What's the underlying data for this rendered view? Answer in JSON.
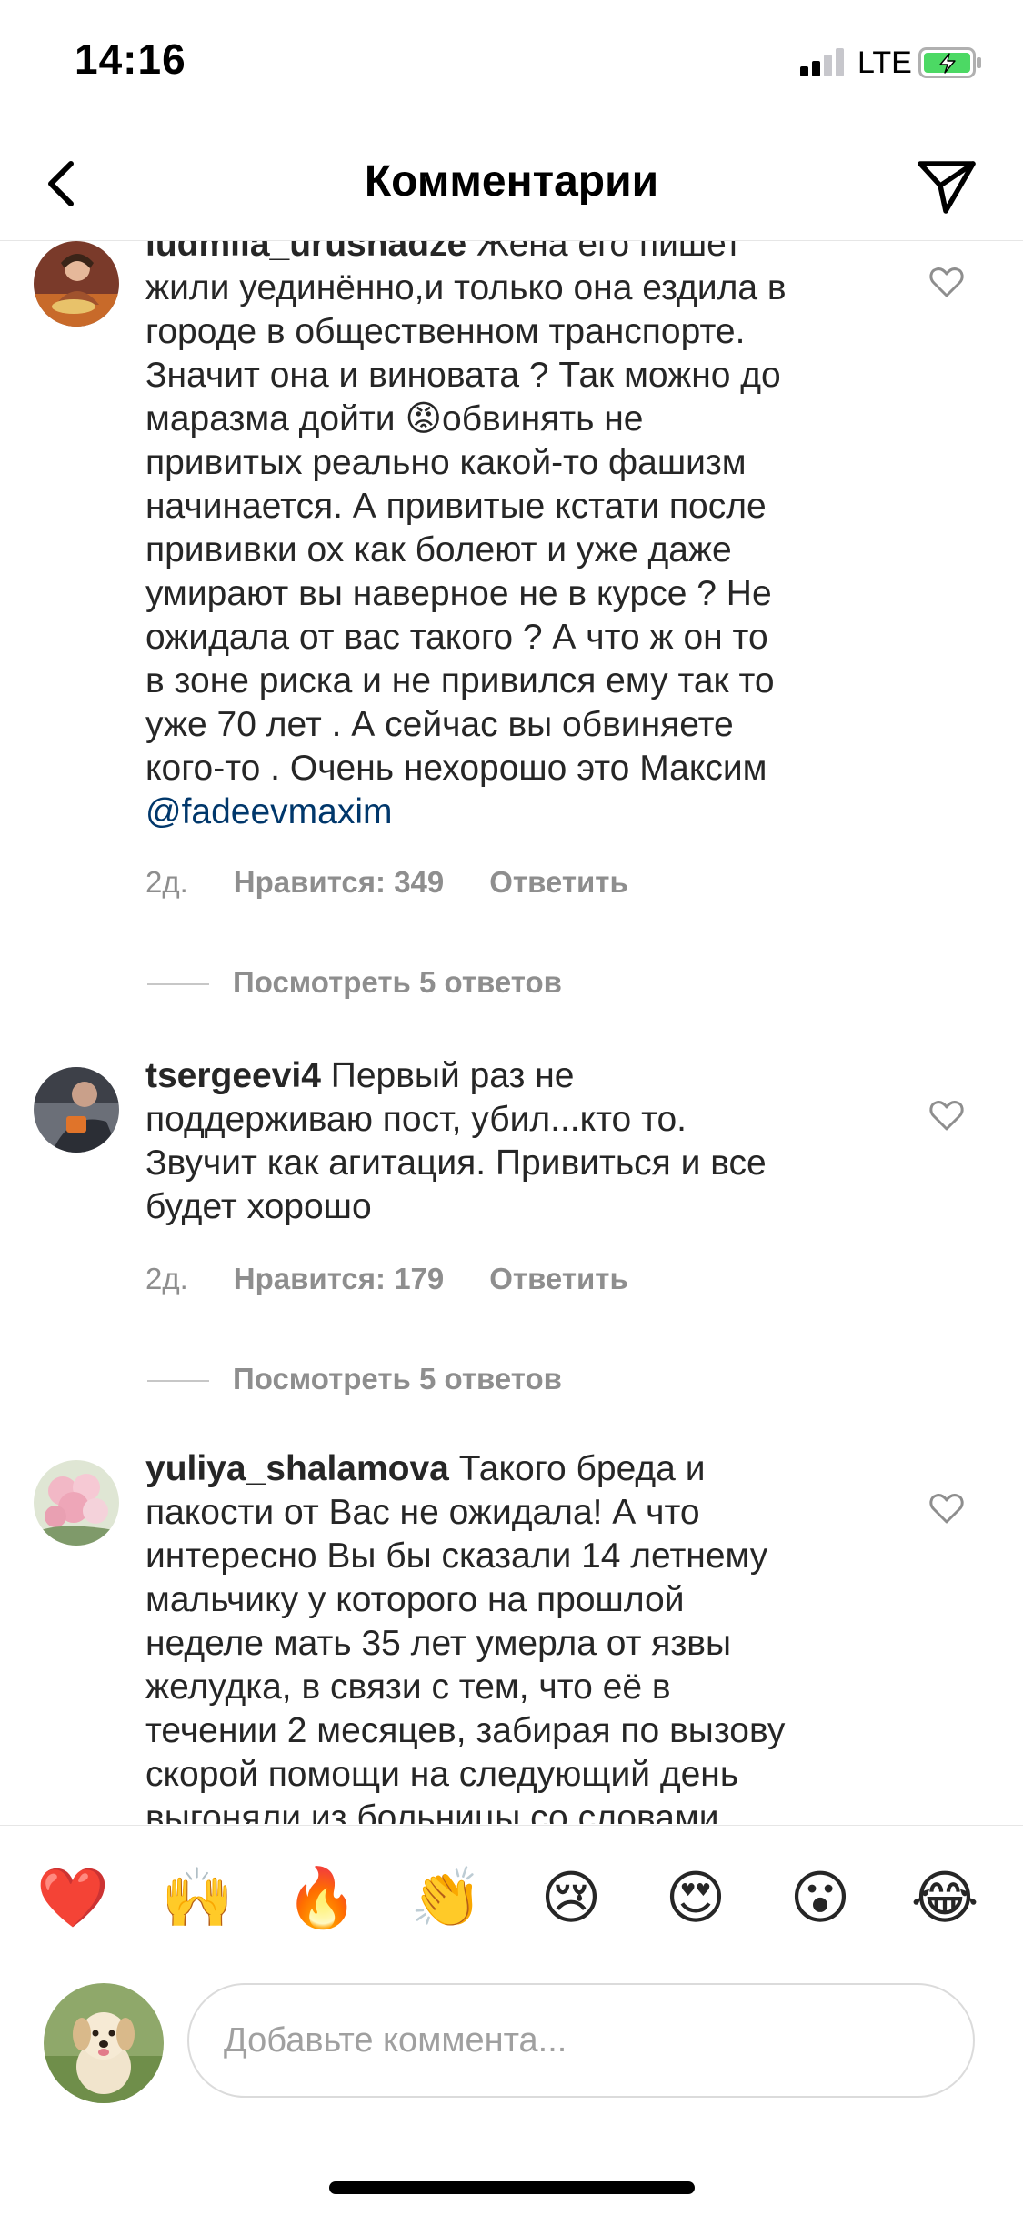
{
  "status_bar": {
    "time": "14:16",
    "network": "LTE",
    "battery_color": "#4cd964"
  },
  "header": {
    "title": "Комментарии",
    "back_icon": "chevron-left-icon",
    "send_icon": "paper-plane-icon"
  },
  "comments": [
    {
      "username": "ludmila_urushadze",
      "text_lines": [
        " Жена его пишет",
        "жили уединённо,и только она ездила в",
        "городе в общественном транспорте.",
        "Значит она и виновата ? Так можно до",
        "маразма дойти 😡обвинять не",
        "привитых реально какой-то фашизм",
        "начинается. А привитые кстати после",
        "прививки ох как болеют и уже даже",
        "умирают вы наверное не в курсе ? Не",
        "ожидала от вас такого ? А что ж он то",
        "в зоне риска и не привился ему так то",
        "уже 70 лет . А сейчас вы обвиняете",
        "кого-то . Очень нехорошо это Максим"
      ],
      "mention": "@fadeevmaxim",
      "time": "2д.",
      "likes": "Нравится: 349",
      "reply": "Ответить",
      "view_replies": "Посмотреть 5 ответов"
    },
    {
      "username": "tsergeevi4",
      "text_lines": [
        " Первый раз не",
        "поддерживаю пост, убил...кто то.",
        "Звучит как агитация. Привиться и все",
        "будет хорошо"
      ],
      "time": "2д.",
      "likes": "Нравится: 179",
      "reply": "Ответить",
      "view_replies": "Посмотреть 5 ответов"
    },
    {
      "username": "yuliya_shalamova",
      "text_lines": [
        " Такого бреда и",
        "пакости от Вас не ожидала! А что",
        "интересно Вы бы сказали 14 летнему",
        "мальчику у которого на прошлой",
        "неделе мать 35 лет умерла от язвы",
        "желудка, в связи с тем, что её в",
        "течении 2 месяцев, забирая по вызову",
        "скорой помощи на следующий день",
        "выгоняли из больницы со словами"
      ]
    }
  ],
  "emoji_bar": [
    "❤️",
    "🙌",
    "🔥",
    "👏",
    "😢",
    "😍",
    "😮",
    "😂"
  ],
  "composer": {
    "placeholder": "Добавьте коммента..."
  }
}
